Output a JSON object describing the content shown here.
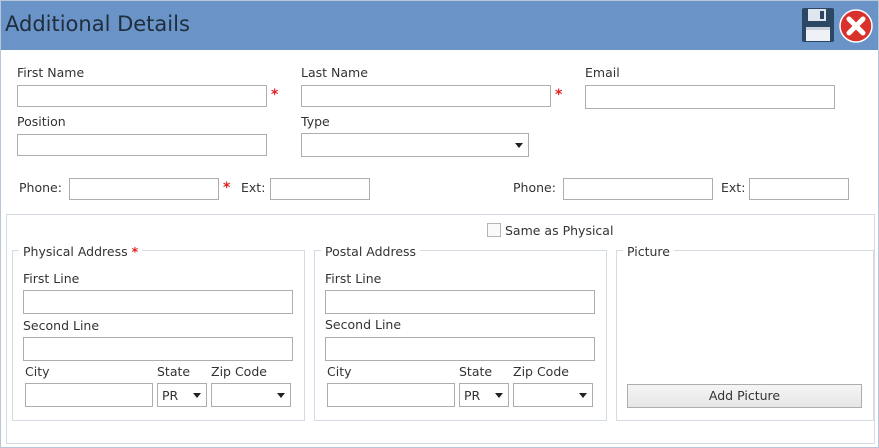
{
  "window": {
    "title": "Additional Details"
  },
  "icons": {
    "save": "save-floppy-icon",
    "close": "close-circle-icon",
    "close_color": "#d9322d",
    "header_color": "#6a93c7"
  },
  "contact": {
    "first_name_label": "First Name",
    "last_name_label": "Last Name",
    "email_label": "Email",
    "position_label": "Position",
    "type_label": "Type",
    "type_value": "",
    "phone_label": "Phone:",
    "ext_label": "Ext:",
    "phone2_label": "Phone:",
    "ext2_label": "Ext:",
    "required_marker": "*"
  },
  "address": {
    "same_as_physical_label": "Same as Physical",
    "physical": {
      "title": "Physical Address",
      "first_line_label": "First Line",
      "second_line_label": "Second Line",
      "city_label": "City",
      "state_label": "State",
      "state_value": "PR",
      "zip_label": "Zip Code"
    },
    "postal": {
      "title": "Postal Address",
      "first_line_label": "First Line",
      "second_line_label": "Second Line",
      "city_label": "City",
      "state_label": "State",
      "state_value": "PR",
      "zip_label": "Zip Code"
    }
  },
  "picture": {
    "title": "Picture",
    "add_button": "Add Picture"
  }
}
